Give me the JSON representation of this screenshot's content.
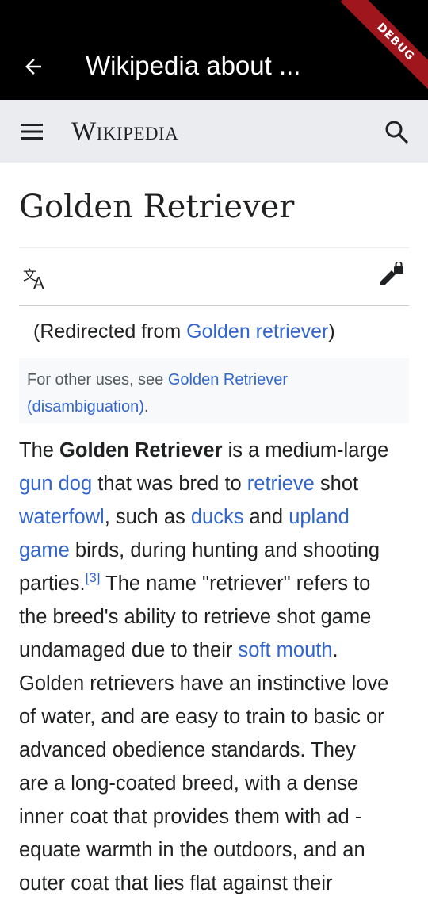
{
  "app_bar": {
    "title": "Wikipedia about ...",
    "debug_banner": "DEBUG"
  },
  "wiki_header": {
    "wordmark": "Wikipedia"
  },
  "article": {
    "title": "Golden Retriever",
    "redirect": {
      "prefix": "(Redirected from ",
      "link": "Golden retriever",
      "suffix": ")"
    },
    "hatnote": {
      "prefix": "For other uses, see ",
      "link_line1": "Golden Retriever",
      "link_line2": "(disambiguation)",
      "suffix": "."
    },
    "body": {
      "l1_text": "The ",
      "l1_bold": "Golden Retriever",
      "l1_text2": " is a medium-large",
      "l2_link1": "gun dog",
      "l2_text": " that was bred to ",
      "l2_link2": "retrieve",
      "l2_text2": " shot",
      "l3_link1": "waterfowl",
      "l3_text": ", such as ",
      "l3_link2": "ducks",
      "l3_text2": " and ",
      "l3_link3": "upland",
      "l4_link1": "game",
      "l4_text": " birds, during hunting and shooting",
      "l5_text": "parties.",
      "l5_ref": "[3]",
      "l5_text2": " The name \"retriever\" refers to",
      "l6_text": "the breed's ability to retrieve shot game",
      "l7_text": "undamaged due to their ",
      "l7_link": "soft mouth",
      "l7_text2": ".",
      "l8_text": "Golden retrievers have an instinctive love",
      "l9_text": "of water, and are easy to train to basic or",
      "l10_text": "advanced obedience standards. They",
      "l11_text": "are a long-coated breed, with a dense",
      "l12_text": "inner coat that provides them with ad -",
      "l13_text": "equate warmth in the outdoors, and an",
      "l14_text": "outer coat that lies flat against their"
    }
  },
  "icons": {
    "back": "arrow-back-icon",
    "menu": "hamburger-menu-icon",
    "search": "search-icon",
    "language": "translate-icon",
    "edit": "edit-locked-icon"
  },
  "colors": {
    "app_bar": "#000000",
    "header_bg": "#eaecf0",
    "link": "#3366cc",
    "text": "#202122",
    "hatnote_bg": "#f8f9fa",
    "debug": "#a0161d"
  }
}
